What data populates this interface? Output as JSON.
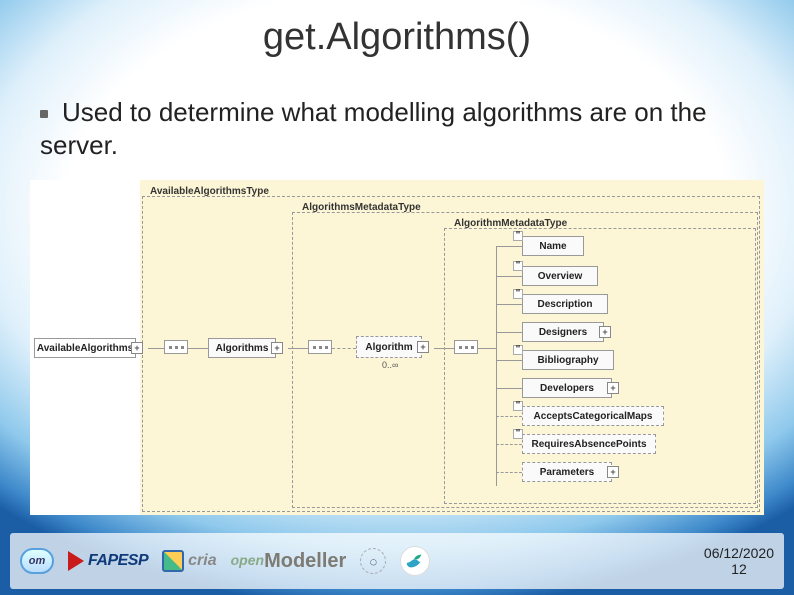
{
  "slide": {
    "title": "get.Algorithms()",
    "bullet": "Used to determine what modelling algorithms are on the server."
  },
  "schema": {
    "type_labels": {
      "available": "AvailableAlgorithmsType",
      "metadata": "AlgorithmsMetadataType",
      "meta": "AlgorithmMetadataType"
    },
    "nodes": {
      "root": "AvailableAlgorithms",
      "algorithms": "Algorithms",
      "algorithm": "Algorithm",
      "name": "Name",
      "overview": "Overview",
      "description": "Description",
      "designers": "Designers",
      "bibliography": "Bibliography",
      "developers": "Developers",
      "accepts": "AcceptsCategoricalMaps",
      "requires": "RequiresAbsencePoints",
      "parameters": "Parameters"
    },
    "multiplicity": "0..∞"
  },
  "footer": {
    "logos": {
      "om": "om",
      "fapesp": "FAPESP",
      "cria": "cria",
      "openmodeller_top": "open",
      "openmodeller": "Modeller"
    },
    "date": "06/12/2020",
    "slide_number": "12"
  }
}
